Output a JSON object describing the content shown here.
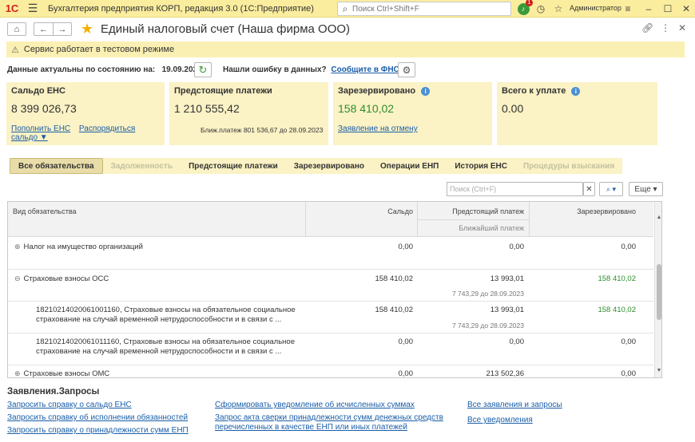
{
  "app": {
    "logo": "1С",
    "title": "Бухгалтерия предприятия КОРП, редакция 3.0  (1С:Предприятие)",
    "search_placeholder": "Поиск Ctrl+Shift+F",
    "notifications_count": "1",
    "user": "Администратор"
  },
  "form": {
    "title": "Единый налоговый счет (Наша фирма ООО)",
    "notice": "Сервис работает в тестовом режиме",
    "actual_label": "Данные актуальны по состоянию на:",
    "actual_date": "19.09.2023",
    "error_question": "Нашли ошибку в данных?",
    "error_link": "Сообщите в ФНС"
  },
  "cards": [
    {
      "title": "Сальдо ЕНС",
      "value": "8 399 026,73",
      "link1": "Пополнить ЕНС",
      "link2": "Распорядиться сальдо ▼"
    },
    {
      "title": "Предстоящие платежи",
      "value": "1 210 555,42",
      "note": "Ближ.платеж 801 536,67 до 28.09.2023"
    },
    {
      "title": "Зарезервировано",
      "value": "158 410,02",
      "link": "Заявление на отмену"
    },
    {
      "title": "Всего к уплате",
      "value": "0.00"
    }
  ],
  "tabs": [
    "Все обязательства",
    "Задолженность",
    "Предстоящие платежи",
    "Зарезервировано",
    "Операции ЕНП",
    "История ЕНС",
    "Процедуры взыскания"
  ],
  "table_controls": {
    "search_placeholder": "Поиск (Ctrl+F)",
    "more_label": "Еще"
  },
  "grid": {
    "headers": {
      "kind": "Вид обязательства",
      "saldo": "Сальдо",
      "upcoming": "Предстоящий платеж",
      "nearest": "Ближайший платеж",
      "reserved": "Зарезервировано"
    },
    "rows": [
      {
        "name": "Налог на имущество организаций",
        "saldo": "0,00",
        "upcoming": "0,00",
        "sub": "",
        "reserved": "0,00"
      },
      {
        "name": "Страховые взносы ОСС",
        "saldo": "158 410,02",
        "upcoming": "13 993,01",
        "sub": "7 743,29 до 28.09.2023",
        "reserved": "158 410,02"
      },
      {
        "name": "18210214020061001160, Страховые взносы на обязательное социальное",
        "name2": "страхование на случай временной нетрудоспособности и в связи с ...",
        "saldo": "158 410,02",
        "upcoming": "13 993,01",
        "sub": "7 743,29 до 28.09.2023",
        "reserved": "158 410,02"
      },
      {
        "name": "18210214020061011160, Страховые взносы на обязательное социальное",
        "name2": "страхование на случай временной нетрудоспособности и в связи с ...",
        "saldo": "0,00",
        "upcoming": "0,00",
        "sub": "",
        "reserved": "0,00"
      },
      {
        "name": "Страховые взносы ОМС",
        "saldo": "0,00",
        "upcoming": "213 502,36",
        "sub": "",
        "reserved": "0,00"
      }
    ]
  },
  "requests": {
    "title": "Заявления.Запросы",
    "col1": [
      "Запросить справку о сальдо ЕНС",
      "Запросить справку об исполнении обязанностей",
      "Запросить справку о принадлежности сумм ЕНП"
    ],
    "col2": [
      "Сформировать уведомление об исчисленных суммах",
      "Запрос акта сверки принадлежности сумм денежных средств",
      "перечисленных в качестве ЕНП или иных платежей"
    ],
    "col3": [
      "Все заявления и запросы",
      "Все уведомления"
    ]
  },
  "colors": {
    "accent_yellow": "#fbed9e",
    "green": "#2d8e2d",
    "link": "#1a5ea8"
  }
}
